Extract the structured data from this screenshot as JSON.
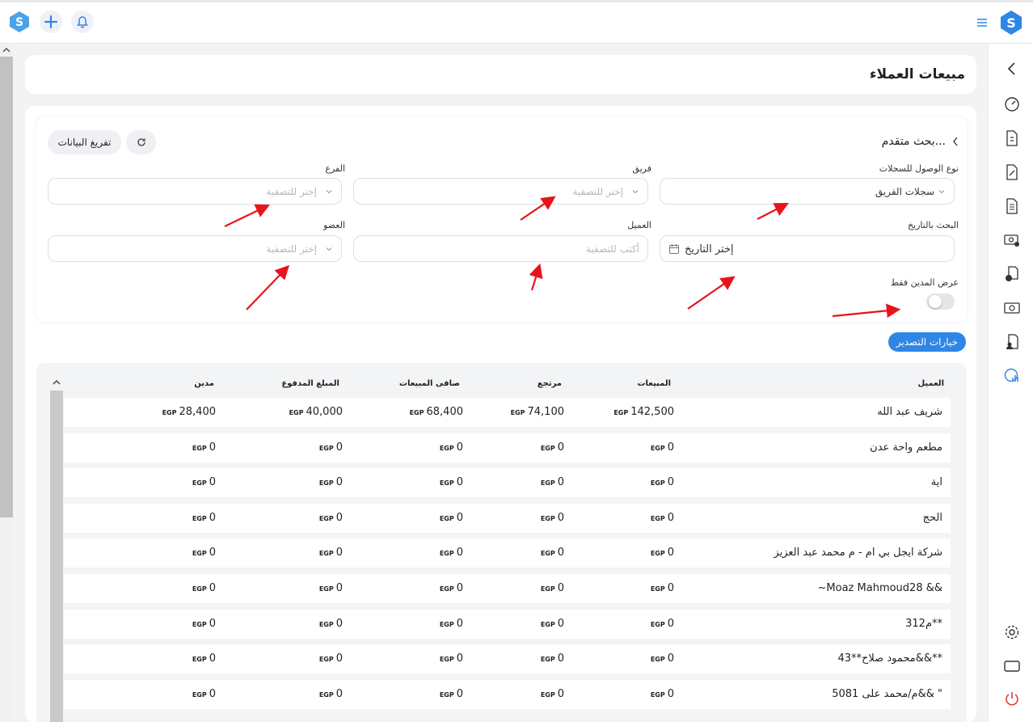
{
  "page": {
    "title": "مبيعات العملاء"
  },
  "filters": {
    "advanced_search_label": "بحث متقدم...",
    "clear_button": "تفريغ البيانات",
    "access_type": {
      "label": "نوع الوصول للسجلات",
      "value": "سجلات الفريق"
    },
    "team": {
      "label": "فريق",
      "placeholder": "إختر للتصفية"
    },
    "branch": {
      "label": "الفرع",
      "placeholder": "إختر للتصفية"
    },
    "date_search": {
      "label": "البحث بالتاريخ",
      "placeholder": "إختر التاريخ"
    },
    "customer": {
      "label": "العميل",
      "placeholder": "أكتب للتصفية"
    },
    "member": {
      "label": "العضو",
      "placeholder": "إختر للتصفية"
    },
    "debtors_only": {
      "label": "عرض المدين فقط",
      "enabled": false
    }
  },
  "export_button": "خيارات التصدير",
  "table": {
    "currency": "EGP",
    "columns": {
      "customer": "العميل",
      "sales": "المبيعات",
      "returns": "مرتجع",
      "net_sales": "صافى المبيعات",
      "paid": "المبلغ المدفوع",
      "debtor": "مدين"
    },
    "rows": [
      {
        "customer": "شريف عبد الله",
        "sales": "142,500",
        "returns": "74,100",
        "net_sales": "68,400",
        "paid": "40,000",
        "debtor": "28,400"
      },
      {
        "customer": "مطعم واحة عدن",
        "sales": "0",
        "returns": "0",
        "net_sales": "0",
        "paid": "0",
        "debtor": "0"
      },
      {
        "customer": "اية",
        "sales": "0",
        "returns": "0",
        "net_sales": "0",
        "paid": "0",
        "debtor": "0"
      },
      {
        "customer": "الحج",
        "sales": "0",
        "returns": "0",
        "net_sales": "0",
        "paid": "0",
        "debtor": "0"
      },
      {
        "customer": "شركة ايجل بي ام - م محمد عبد العزيز",
        "sales": "0",
        "returns": "0",
        "net_sales": "0",
        "paid": "0",
        "debtor": "0"
      },
      {
        "customer": "~Moaz Mahmoud28      &&",
        "sales": "0",
        "returns": "0",
        "net_sales": "0",
        "paid": "0",
        "debtor": "0"
      },
      {
        "customer": "م312**",
        "sales": "0",
        "returns": "0",
        "net_sales": "0",
        "paid": "0",
        "debtor": "0"
      },
      {
        "customer": "محمود صلاح**43&&**",
        "sales": "0",
        "returns": "0",
        "net_sales": "0",
        "paid": "0",
        "debtor": "0"
      },
      {
        "customer": "م/محمد على 5081&&  \"",
        "sales": "0",
        "returns": "0",
        "net_sales": "0",
        "paid": "0",
        "debtor": "0"
      }
    ]
  },
  "colors": {
    "accent": "#2e86e6",
    "annotation_arrow": "#e8141b"
  }
}
